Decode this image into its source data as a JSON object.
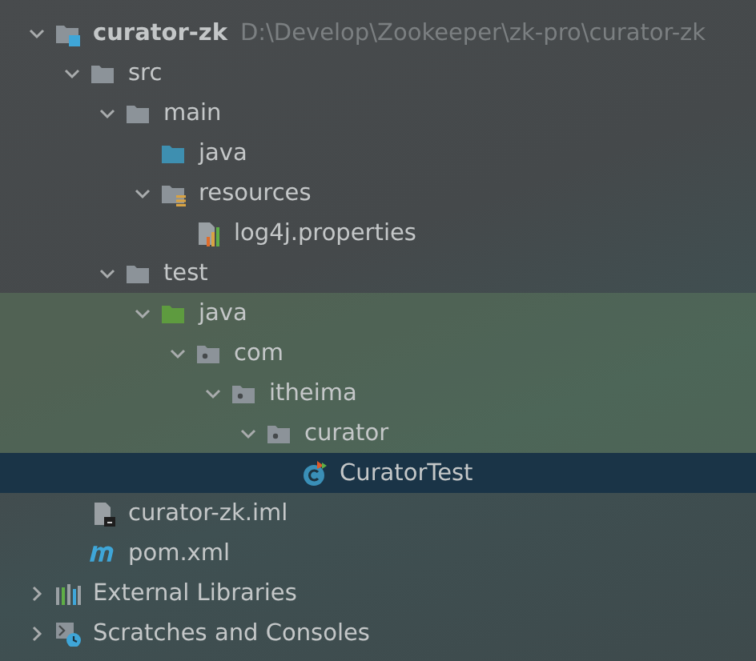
{
  "tree": [
    {
      "name": "curator-zk",
      "path": "D:\\Develop\\Zookeeper\\zk-pro\\curator-zk",
      "kind": "module",
      "expanded": true,
      "selected": false,
      "children": [
        {
          "name": "src",
          "kind": "folder",
          "expanded": true,
          "selected": false,
          "children": [
            {
              "name": "main",
              "kind": "folder",
              "expanded": true,
              "selected": false,
              "children": [
                {
                  "name": "java",
                  "kind": "source",
                  "selected": false
                },
                {
                  "name": "resources",
                  "kind": "resources",
                  "expanded": true,
                  "selected": false,
                  "children": [
                    {
                      "name": "log4j.properties",
                      "kind": "properties",
                      "selected": false
                    }
                  ]
                }
              ]
            },
            {
              "name": "test",
              "kind": "folder",
              "expanded": true,
              "selected": false,
              "children": [
                {
                  "name": "java",
                  "kind": "test-source",
                  "expanded": true,
                  "selected": false,
                  "test_scope": true,
                  "children": [
                    {
                      "name": "com",
                      "kind": "package",
                      "expanded": true,
                      "selected": false,
                      "test_scope": true,
                      "children": [
                        {
                          "name": "itheima",
                          "kind": "package",
                          "expanded": true,
                          "selected": false,
                          "test_scope": true,
                          "children": [
                            {
                              "name": "curator",
                              "kind": "package",
                              "expanded": true,
                              "selected": false,
                              "test_scope": true,
                              "children": [
                                {
                                  "name": "CuratorTest",
                                  "kind": "class",
                                  "selected": true
                                }
                              ]
                            }
                          ]
                        }
                      ]
                    }
                  ]
                }
              ]
            }
          ]
        },
        {
          "name": "curator-zk.iml",
          "kind": "iml",
          "selected": false
        },
        {
          "name": "pom.xml",
          "kind": "maven",
          "selected": false
        }
      ]
    },
    {
      "name": "External Libraries",
      "kind": "libraries",
      "expanded": false,
      "selected": false
    },
    {
      "name": "Scratches and Consoles",
      "kind": "scratches",
      "expanded": false,
      "selected": false
    }
  ]
}
